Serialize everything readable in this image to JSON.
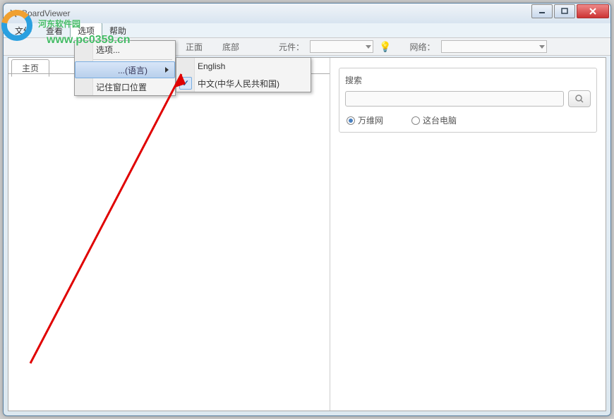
{
  "titlebar": {
    "title": "BoardViewer"
  },
  "menubar": {
    "file": "文件",
    "view": "查看",
    "options": "选项",
    "help": "帮助"
  },
  "toolbar": {
    "front": "正面",
    "bottom": "底部",
    "component_label": "元件：",
    "network_label": "网络："
  },
  "tab": {
    "home": "主页"
  },
  "dropdown_options": {
    "options": "选项...",
    "language": "...(语言)",
    "remember_pos": "记住窗口位置"
  },
  "dropdown_lang": {
    "english": "English",
    "chinese": "中文(中华人民共和国)"
  },
  "search_panel": {
    "label": "搜索",
    "radio_web": "万维网",
    "radio_pc": "这台电脑"
  },
  "watermark": {
    "brand_prefix_logo": "",
    "brand_text": "河东软件园",
    "url": "www.pc0359.cn"
  }
}
